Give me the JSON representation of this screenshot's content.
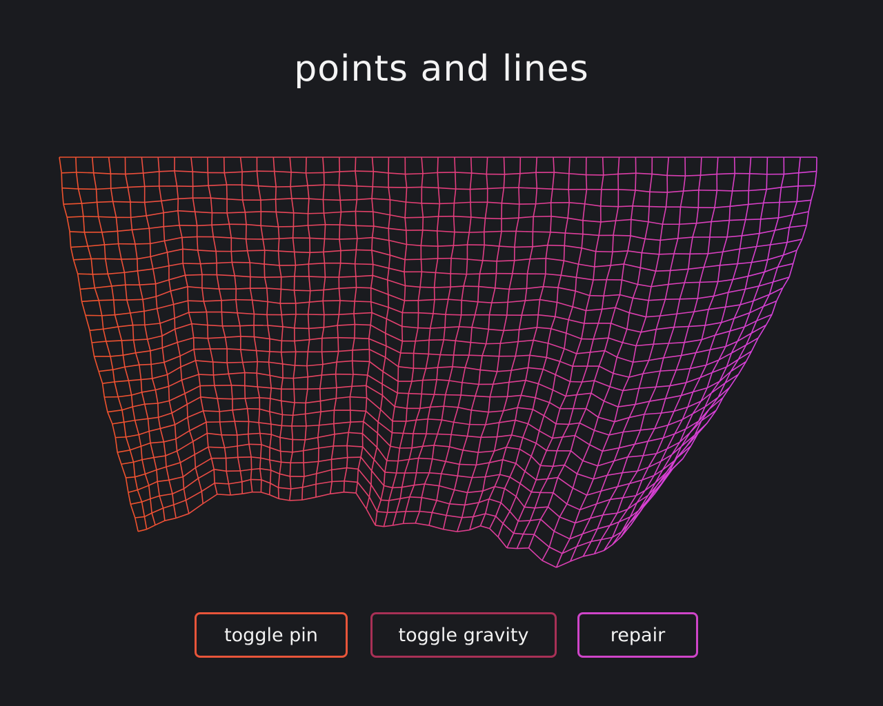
{
  "page": {
    "title": "points and lines"
  },
  "canvas": {
    "colors": {
      "left": "#f0532e",
      "mid": "#e23d7a",
      "right": "#d640d9"
    }
  },
  "buttons": {
    "toggle_pin": {
      "label": "toggle pin",
      "color": "#e8553a"
    },
    "toggle_gravity": {
      "label": "toggle gravity",
      "color": "#a83056"
    },
    "repair": {
      "label": "repair",
      "color": "#cf45c9"
    }
  }
}
